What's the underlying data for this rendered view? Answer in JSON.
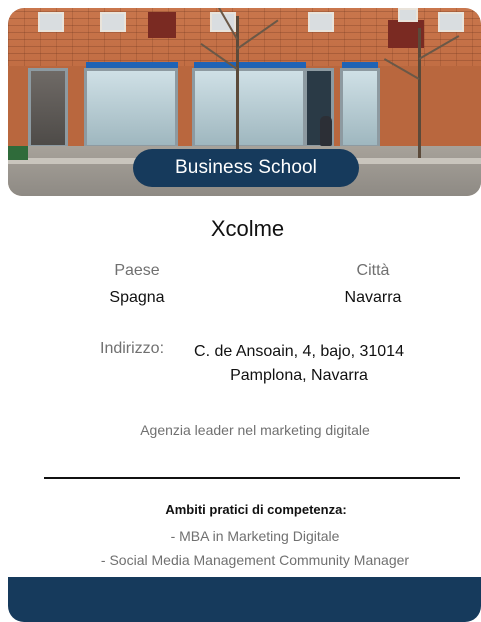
{
  "hero": {
    "photo_label": "storefront-photo",
    "badge": "Business School"
  },
  "company": {
    "name": "Xcolme"
  },
  "location": {
    "paese_label": "Paese",
    "paese_value": "Spagna",
    "citta_label": "Città",
    "citta_value": "Navarra"
  },
  "address": {
    "label": "Indirizzo:",
    "line1": "C. de Ansoain, 4, bajo, 31014",
    "line2": "Pamplona, Navarra"
  },
  "description": "Agenzia leader nel marketing digitale",
  "ambiti": {
    "title": "Ambiti pratici di competenza:",
    "items": [
      "- MBA in Marketing Digitale",
      "- Social Media Management Community Manager"
    ]
  },
  "colors": {
    "accent": "#163a5c",
    "muted_text": "#707070",
    "text": "#111111"
  }
}
